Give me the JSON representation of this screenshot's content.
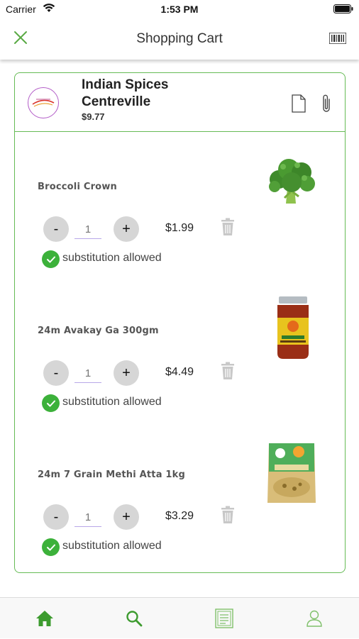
{
  "status_bar": {
    "carrier": "Carrier",
    "time": "1:53 PM"
  },
  "nav": {
    "title": "Shopping Cart"
  },
  "store": {
    "name": "Indian Spices Centreville",
    "total": "$9.77"
  },
  "items": [
    {
      "name": "Broccoli Crown",
      "quantity_placeholder": "1",
      "price": "$1.99",
      "substitution_label": "substitution allowed",
      "substitution_allowed": true
    },
    {
      "name": "24m Avakay Ga 300gm",
      "quantity_placeholder": "1",
      "price": "$4.49",
      "substitution_label": "substitution allowed",
      "substitution_allowed": true
    },
    {
      "name": "24m 7 Grain Methi Atta 1kg",
      "quantity_placeholder": "1",
      "price": "$3.29",
      "substitution_label": "substitution allowed",
      "substitution_allowed": true
    }
  ],
  "qty_controls": {
    "minus": "-",
    "plus": "+"
  },
  "tabs": [
    {
      "id": "home",
      "icon": "home-icon",
      "active": true
    },
    {
      "id": "search",
      "icon": "search-icon",
      "active": false
    },
    {
      "id": "orders",
      "icon": "list-icon",
      "active": false
    },
    {
      "id": "profile",
      "icon": "user-icon",
      "active": false
    }
  ],
  "colors": {
    "accent": "#3cb13a",
    "border": "#66bb55",
    "nav_icon": "#5aaa45"
  }
}
